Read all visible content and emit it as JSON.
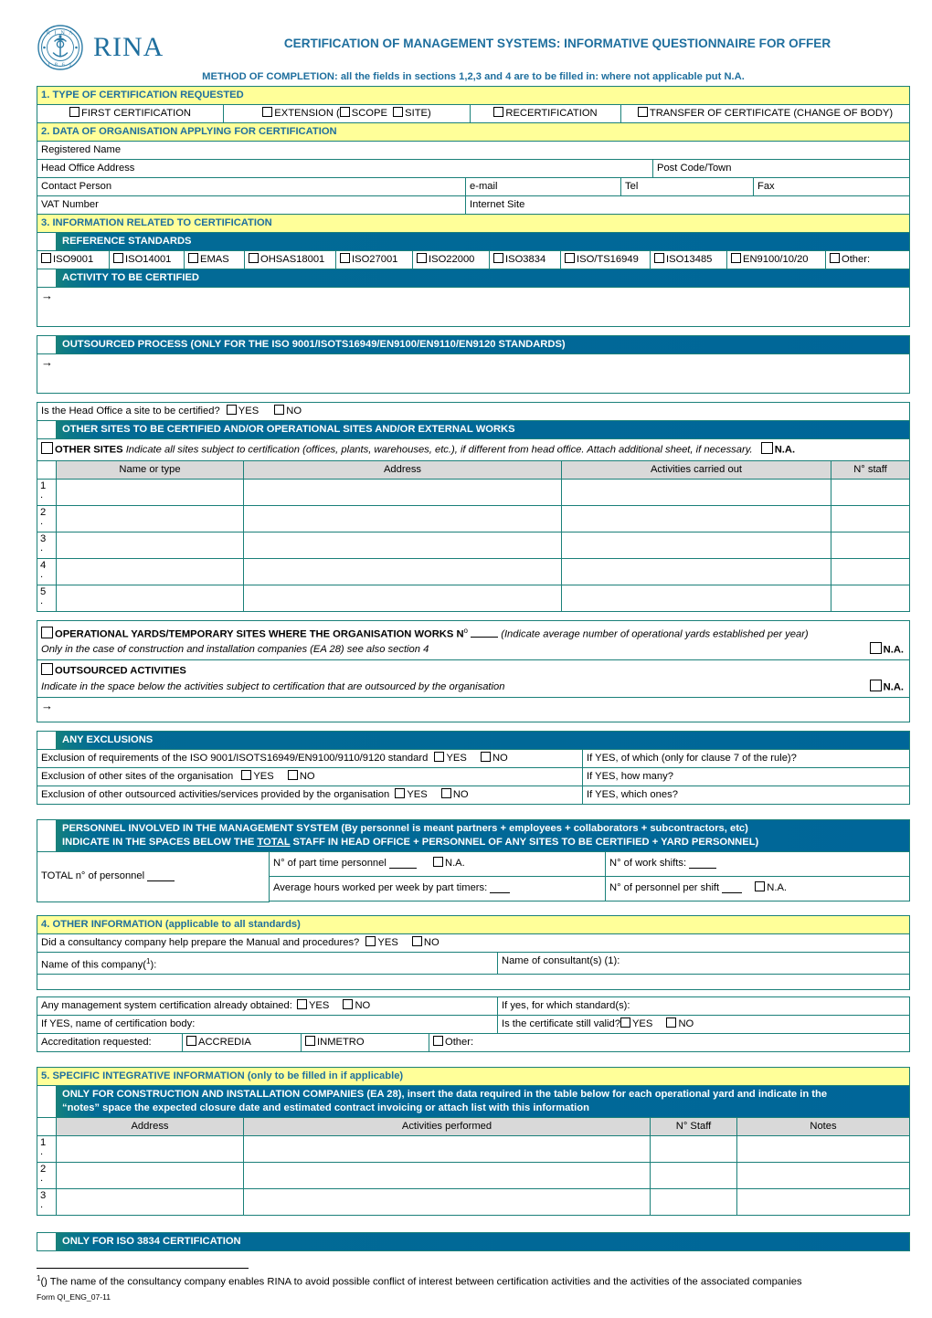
{
  "header": {
    "logo_text": "RINA",
    "seal_top": "R I N A",
    "seal_bottom": "1 8 6 1",
    "title": "CERTIFICATION OF MANAGEMENT SYSTEMS: INFORMATIVE QUESTIONNAIRE FOR OFFER",
    "method": "METHOD OF COMPLETION: all the fields in sections 1,2,3 and 4 are to be filled in: where not applicable put N.A."
  },
  "colors": {
    "title_blue": "#1f6f9e",
    "band_blue": "#006699",
    "band_teal": "#16817c",
    "yellow": "#ffff99",
    "border_teal": "#1a8079",
    "header_grey": "#d9d9d9"
  },
  "section1": {
    "title": "1. TYPE OF CERTIFICATION REQUESTED",
    "options": [
      "FIRST CERTIFICATION",
      "EXTENSION (",
      "SCOPE",
      "SITE)",
      "RECERTIFICATION",
      "TRANSFER OF CERTIFICATE (CHANGE OF BODY)"
    ]
  },
  "section2": {
    "title": "2. DATA OF ORGANISATION APPLYING FOR CERTIFICATION",
    "registered_name": "Registered Name",
    "head_office_address": "Head Office Address",
    "post_code_town": "Post Code/Town",
    "contact_person": "Contact Person",
    "email": "e-mail",
    "tel": "Tel",
    "fax": "Fax",
    "vat_number": "VAT Number",
    "internet_site": "Internet Site"
  },
  "section3": {
    "title": "3. INFORMATION RELATED TO CERTIFICATION",
    "reference_standards_bar": "REFERENCE STANDARDS",
    "standards": [
      "ISO9001",
      "ISO14001",
      "EMAS",
      "OHSAS18001",
      "ISO27001",
      "ISO22000",
      "ISO3834",
      "ISO/TS16949",
      "ISO13485",
      "EN9100/10/20",
      "Other:"
    ],
    "activity_bar": "ACTIVITY TO BE CERTIFIED",
    "outsourced_process_bar": "OUTSOURCED PROCESS (ONLY FOR THE ISO 9001/ISOTS16949/EN9100/EN9110/EN9120 STANDARDS)",
    "head_office_question": "Is the Head Office a site to be certified?",
    "yes": "YES",
    "no": "NO",
    "other_sites_bar": "OTHER SITES TO BE CERTIFIED AND/OR  OPERATIONAL SITES AND/OR EXTERNAL WORKS",
    "other_sites_label": "OTHER SITES",
    "other_sites_note": "Indicate all sites subject to certification (offices, plants, warehouses, etc.), if different from head office. Attach additional sheet, if necessary.",
    "na": "N.A.",
    "sites_table": {
      "columns": [
        "Name or type",
        "Address",
        "Activities carried out",
        "N° staff"
      ],
      "rows": [
        "1",
        "2",
        "3",
        "4",
        "5"
      ]
    },
    "yards_label": "OPERATIONAL YARDS/TEMPORARY SITES WHERE THE ORGANISATION WORKS N",
    "yards_sup": "o",
    "yards_note": "(Indicate average number of operational yards established per year)",
    "yards_line2": "Only in the case of construction and installation companies (EA 28) see also section 4",
    "outsourced_activities_label": "OUTSOURCED ACTIVITIES",
    "outsourced_activities_note": "Indicate in the space below the activities subject to certification that are outsourced by the organisation",
    "exclusions_bar": "ANY EXCLUSIONS",
    "exclusions": [
      {
        "left": "Exclusion of requirements of the ISO 9001/ISOTS16949/EN9100/9110/9120 standard",
        "right": "If YES, of which (only for clause 7 of the rule)?"
      },
      {
        "left": "Exclusion of other sites of the organisation",
        "right": "If YES, how many?"
      },
      {
        "left": "Exclusion of other outsourced activities/services provided by the organisation",
        "right": "If YES, which ones?"
      }
    ],
    "personnel_bar_line1": "PERSONNEL INVOLVED IN THE MANAGEMENT SYSTEM  (By personnel is meant partners + employees + collaborators + subcontractors, etc)",
    "personnel_bar_line2_a": "INDICATE IN THE SPACES BELOW THE ",
    "personnel_bar_line2_total": "TOTAL",
    "personnel_bar_line2_b": " STAFF IN HEAD OFFICE + PERSONNEL OF ANY SITES TO BE CERTIFIED + YARD PERSONNEL)",
    "total_personnel": "TOTAL n° of personnel",
    "part_time": "N° of part time personnel",
    "work_shifts": "N° of work shifts:",
    "avg_hours": "Average hours worked per week by part timers:",
    "personnel_per_shift": "N° of personnel per shift"
  },
  "section4": {
    "title": "4. OTHER INFORMATION (applicable to all standards)",
    "consultancy_question": "Did a consultancy company help prepare the Manual and procedures?",
    "yes": "YES",
    "no": "NO",
    "company_name": "Name of this company(",
    "company_name_sup": "1",
    "company_name_end": "):",
    "consultant_name": "Name of consultant(s) (1):",
    "already_obtained": "Any management system certification already obtained:",
    "for_which_standards": "If yes, for which standard(s):",
    "cert_body": "If YES, name of certification body:",
    "still_valid": "Is the certificate still valid?",
    "accreditation": "Accreditation requested:",
    "accreditation_options": [
      "ACCREDIA",
      "INMETRO",
      "Other:"
    ]
  },
  "section5": {
    "title": "5. SPECIFIC INTEGRATIVE INFORMATION (only to be filled in if applicable)",
    "ea28_line1": "ONLY FOR CONSTRUCTION AND INSTALLATION COMPANIES (EA 28), insert the data required in the table below for each operational yard and indicate in the",
    "ea28_line2": "“notes” space the expected closure date and estimated contract invoicing or attach list with this information",
    "yards_table": {
      "columns": [
        "Address",
        "Activities performed",
        "N° Staff",
        "Notes"
      ],
      "rows": [
        "1",
        "2",
        "3"
      ]
    },
    "iso3834_bar": "ONLY FOR ISO 3834 CERTIFICATION"
  },
  "footer": {
    "footnote_sup": "1",
    "footnote_text": "() The name of the consultancy company enables RINA to avoid possible conflict of interest between certification activities and the activities of the associated companies",
    "form_code": "Form QI_ENG_07-11"
  }
}
